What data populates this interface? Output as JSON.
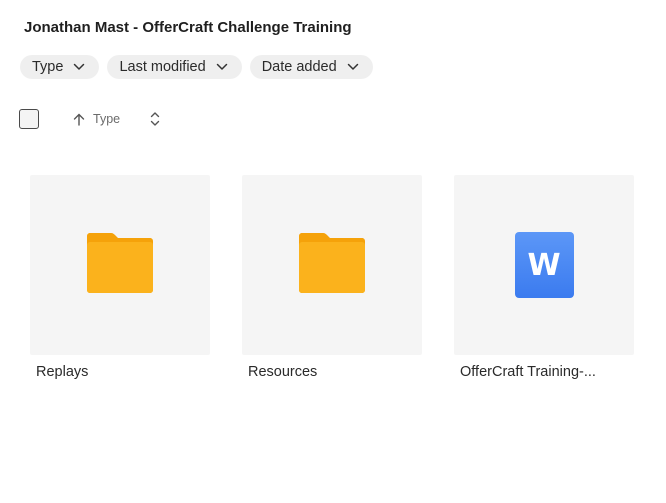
{
  "header": {
    "title": "Jonathan Mast - OfferCraft Challenge Training"
  },
  "filters": [
    {
      "label": "Type"
    },
    {
      "label": "Last modified"
    },
    {
      "label": "Date added"
    }
  ],
  "sort": {
    "label": "Type"
  },
  "items": [
    {
      "name": "Replays",
      "kind": "folder",
      "icon": "folder-icon"
    },
    {
      "name": "Resources",
      "kind": "folder",
      "icon": "folder-icon"
    },
    {
      "name": "OfferCraft Training-...",
      "kind": "document",
      "icon": "word-doc-icon",
      "icon_letter": "W"
    }
  ],
  "colors": {
    "folder": "#fbb21c",
    "word": "#4a86f5",
    "chip_bg": "#efefef",
    "thumb_bg": "#f5f5f5"
  }
}
